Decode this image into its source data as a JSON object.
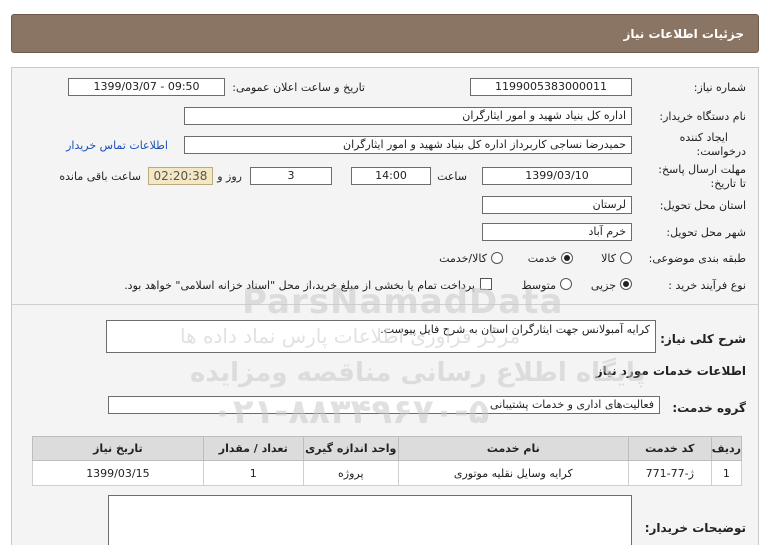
{
  "header": {
    "title": "جزئیات اطلاعات نیاز"
  },
  "fields": {
    "need_number_label": "شماره نیاز:",
    "need_number": "1199005383000011",
    "announce_label": "تاریخ و ساعت اعلان عمومی:",
    "announce_value": "1399/03/07 - 09:50",
    "buyer_org_label": "نام دستگاه خریدار:",
    "buyer_org": "اداره کل بنیاد شهید و امور ایثارگران",
    "requester_label_1": "ایجاد کننده",
    "requester_label_2": "درخواست:",
    "requester": "حمیدرضا نساجی کاربرداز اداره کل بنیاد شهید و امور ایثارگران",
    "buyer_contact_link": "اطلاعات تماس خریدار",
    "deadline_label_1": "مهلت ارسال پاسخ:",
    "deadline_label_2": "تا تاریخ:",
    "deadline_date": "1399/03/10",
    "hour_label": "ساعت",
    "deadline_time": "14:00",
    "days_value": "3",
    "day_and_label": "روز و",
    "remaining_time": "02:20:38",
    "remaining_label": "ساعت باقی مانده",
    "province_label": "استان محل تحویل:",
    "province": "لرستان",
    "city_label": "شهر محل تحویل:",
    "city": "خرم آباد",
    "category_label": "طبقه بندی موضوعی:",
    "category_options": [
      "کالا",
      "خدمت",
      "کالا/خدمت"
    ],
    "process_label": "نوع فرآیند خرید :",
    "process_options": [
      "جزیی",
      "متوسط"
    ],
    "payment_note": "پرداخت تمام یا بخشی از مبلغ خرید،از محل \"اسناد خزانه اسلامی\" خواهد بود."
  },
  "description": {
    "label": "شرح کلی نیاز:",
    "value": "کرایه آمبولانس جهت ایثارگران استان به شرح فایل پیوست."
  },
  "services_section": {
    "title": "اطلاعات خدمات مورد نیاز",
    "group_label": "گروه خدمت:",
    "group_value": "فعالیت‌های اداری و خدمات پشتیبانی"
  },
  "table": {
    "headers": [
      "ردیف",
      "کد خدمت",
      "نام خدمت",
      "واحد اندازه گیری",
      "تعداد / مقدار",
      "تاریخ نیاز"
    ],
    "rows": [
      [
        "1",
        "ژ-77-771",
        "کرایه وسایل نقلیه موتوری",
        "پروژه",
        "1",
        "1399/03/15"
      ]
    ]
  },
  "buyer_notes": {
    "label": "توضیحات خریدار:",
    "value": ""
  },
  "watermark": {
    "brand": "ParsNamadData",
    "line1": "مرکز فراوری اطلاعات پارس نماد داده ها",
    "line2": "پایگاه اطلاع رسانی مناقصه ومزایده",
    "phone": "۰۲۱-۸۸۳۴۹۶۷۰-۵"
  },
  "colors": {
    "header_bg": "#8a7464",
    "panel_bg": "#f4f4f4",
    "time_left_bg": "#f3e7c4",
    "link": "#1a4fb3"
  }
}
